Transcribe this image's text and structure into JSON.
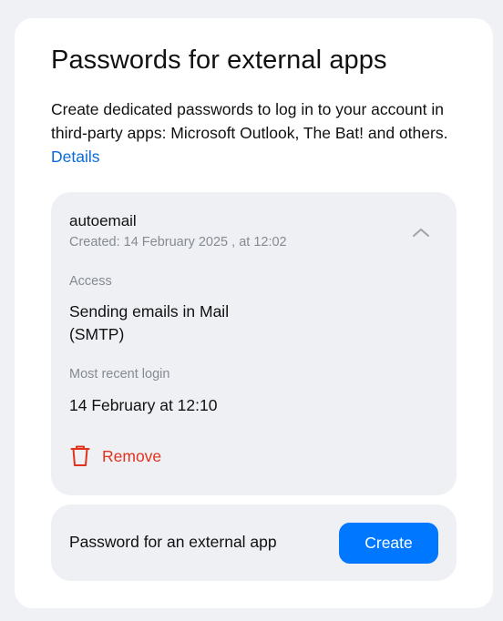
{
  "header": {
    "title": "Passwords for external apps",
    "description": "Create dedicated passwords to log in to your account in third-party apps: Microsoft Outlook, The Bat! and others.",
    "details_link": "Details"
  },
  "app_password": {
    "name": "autoemail",
    "created": "Created: 14 February 2025 , at 12:02",
    "access_label": "Access",
    "access_value_line1": "Sending emails in Mail",
    "access_value_line2": "(SMTP)",
    "last_login_label": "Most recent login",
    "last_login_value": "14 February at 12:10",
    "remove_label": "Remove",
    "collapse_icon": "chevron-up-icon",
    "remove_icon": "trash-icon"
  },
  "create_section": {
    "label": "Password for an external app",
    "button_label": "Create"
  },
  "colors": {
    "accent": "#0077ff",
    "link": "#0a6ad6",
    "danger": "#e0321c",
    "panel_bg": "#eef0f4",
    "muted_text": "#868a92"
  }
}
